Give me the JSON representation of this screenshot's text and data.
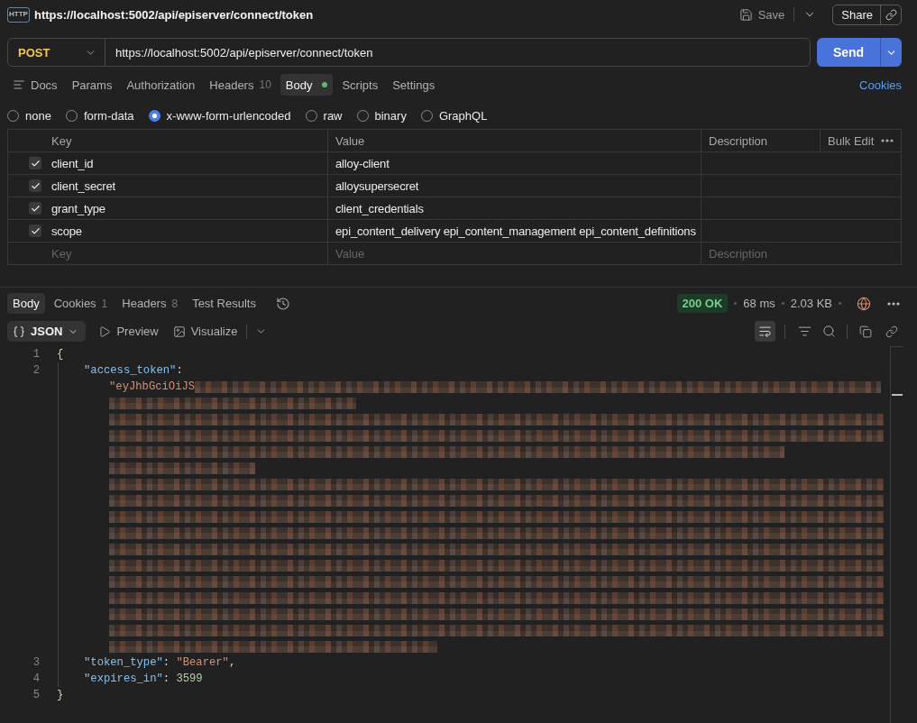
{
  "window": {
    "badge": "HTTP",
    "title": "https://localhost:5002/api/episerver/connect/token",
    "save": "Save",
    "share": "Share"
  },
  "request": {
    "method": "POST",
    "url": "https://localhost:5002/api/episerver/connect/token",
    "send": "Send"
  },
  "request_tabs": [
    {
      "kind": "docs",
      "label": "Docs",
      "selected": false,
      "has_content": false
    },
    {
      "kind": "plain",
      "label": "Params",
      "selected": false,
      "has_content": false
    },
    {
      "kind": "plain",
      "label": "Authorization",
      "selected": false,
      "has_content": false
    },
    {
      "kind": "plain",
      "label": "Headers",
      "count": "10",
      "selected": false,
      "has_content": false
    },
    {
      "kind": "plain",
      "label": "Body",
      "selected": true,
      "has_content": true
    },
    {
      "kind": "plain",
      "label": "Scripts",
      "selected": false,
      "has_content": false
    },
    {
      "kind": "plain",
      "label": "Settings",
      "selected": false,
      "has_content": false
    }
  ],
  "cookies_link": "Cookies",
  "body_types": [
    {
      "label": "none",
      "selected": false
    },
    {
      "label": "form-data",
      "selected": false
    },
    {
      "label": "x-www-form-urlencoded",
      "selected": true
    },
    {
      "label": "raw",
      "selected": false
    },
    {
      "label": "binary",
      "selected": false
    },
    {
      "label": "GraphQL",
      "selected": false
    }
  ],
  "params_table": {
    "columns": [
      "Key",
      "Value",
      "Description"
    ],
    "bulk_edit": "Bulk Edit",
    "rows": [
      {
        "checked": true,
        "key": "client_id",
        "value": "alloy-client"
      },
      {
        "checked": true,
        "key": "client_secret",
        "value": "alloysupersecret"
      },
      {
        "checked": true,
        "key": "grant_type",
        "value": "client_credentials"
      },
      {
        "checked": true,
        "key": "scope",
        "value": "epi_content_delivery epi_content_management epi_content_definitions"
      }
    ],
    "new_row": [
      {
        "placeholder": "Key"
      },
      {
        "placeholder": "Value"
      },
      {
        "placeholder": "Description"
      }
    ]
  },
  "response": {
    "tabs": [
      {
        "label": "Body",
        "selected": true
      },
      {
        "label": "Cookies",
        "count": "1",
        "selected": false
      },
      {
        "label": "Headers",
        "count": "8",
        "selected": false
      },
      {
        "label": "Test Results",
        "selected": false
      }
    ],
    "status": "200 OK",
    "time": "68 ms",
    "size": "2.03 KB",
    "format": "JSON",
    "views": [
      {
        "kind": "preview",
        "label": "Preview"
      },
      {
        "kind": "visualize",
        "label": "Visualize"
      }
    ],
    "wrap_lines": true,
    "body": {
      "open": {
        "number": "1",
        "text": "{"
      },
      "members": [
        {
          "kind": "string",
          "number": "2",
          "key": "\"access_token\"",
          "colon": ":",
          "value": "\"eyJhbGciOiJS",
          "wrapped": true,
          "redacted": true
        },
        {
          "kind": "string",
          "number": "3",
          "key": "\"token_type\"",
          "colon": ":",
          "value": "\"Bearer\"",
          "wrapped": false,
          "redacted": false,
          "trail": ","
        },
        {
          "kind": "number",
          "number": "4",
          "key": "\"expires_in\"",
          "colon": ":",
          "value": "3599",
          "wrapped": false,
          "redacted": false
        }
      ],
      "close": {
        "number": "5",
        "text": "}"
      }
    }
  }
}
